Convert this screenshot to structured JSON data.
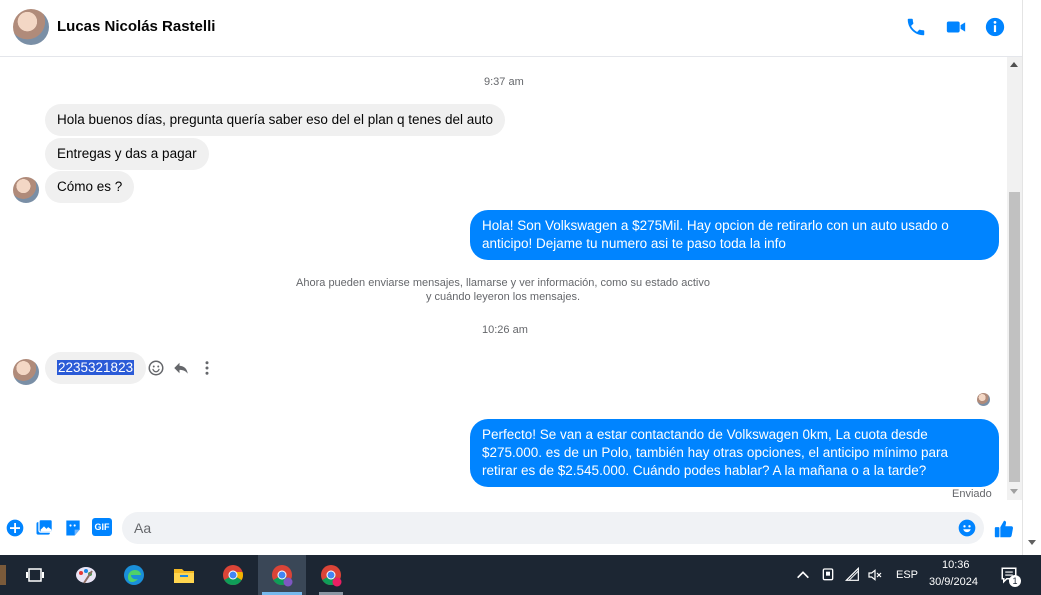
{
  "header": {
    "contact_name": "Lucas Nicolás Rastelli",
    "icons": [
      "phone-icon",
      "video-icon",
      "info-icon"
    ],
    "accent_color": "#0084ff"
  },
  "chat": {
    "timestamp_1": "9:37 am",
    "incoming_1": "Hola buenos días, pregunta quería saber eso del el plan q tenes del auto",
    "incoming_2": "Entregas y das a pagar",
    "incoming_3": "Cómo es ?",
    "outgoing_1": "Hola! Son Volkswagen a $275Mil. Hay opcion de retirarlo con un auto usado o anticipo! Dejame tu numero asi te paso toda la info",
    "system_note_line1": "Ahora pueden enviarse mensajes, llamarse y ver información, como su estado activo",
    "system_note_line2": "y cuándo leyeron los mensajes.",
    "timestamp_2": "10:26 am",
    "incoming_4": "2235321823",
    "outgoing_2": "Perfecto!  Se van a estar contactando de Volkswagen 0km, La cuota desde $275.000. es de un Polo, también hay otras opciones, el anticipo mínimo para retirar es de $2.545.000. Cuándo podes hablar? A la mañana o a la tarde?",
    "sent_status": "Enviado"
  },
  "composer": {
    "placeholder": "Aa",
    "gif_label": "GIF",
    "icons": [
      "plus-icon",
      "image-icon",
      "sticker-icon",
      "gif-icon",
      "emoji-icon",
      "like-icon"
    ]
  },
  "taskbar": {
    "language": "ESP",
    "time": "10:36",
    "date": "30/9/2024",
    "notification_count": "1"
  }
}
